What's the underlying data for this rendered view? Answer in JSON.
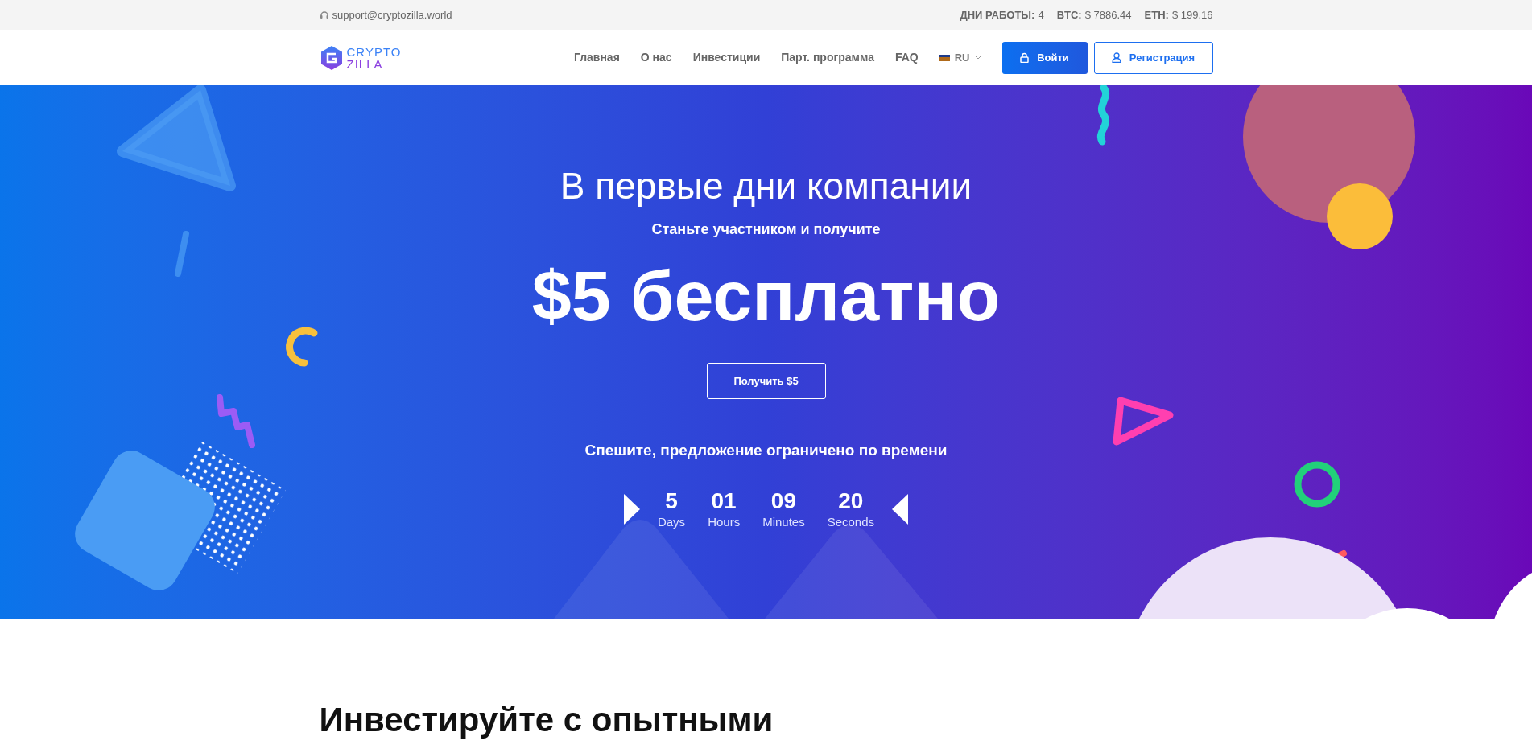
{
  "top_bar": {
    "email": "support@cryptozilla.world",
    "stats": [
      {
        "label": "ДНИ РАБОТЫ:",
        "value": "4"
      },
      {
        "label": "BTC:",
        "value": "$ 7886.44"
      },
      {
        "label": "ETH:",
        "value": "$ 199.16"
      }
    ]
  },
  "header": {
    "logo": {
      "line_1": "CRYPTO",
      "line_2": "ZILLA"
    },
    "nav": [
      "Главная",
      "О нас",
      "Инвестиции",
      "Парт. программа",
      "FAQ"
    ],
    "language": "RU",
    "buttons": [
      {
        "label": "Войти",
        "kind": "primary"
      },
      {
        "label": "Регистрация",
        "kind": "outline"
      }
    ]
  },
  "hero": {
    "title": "В первые дни компании",
    "subtitle": "Станьте участником и получите",
    "headline": "$5 бесплатно",
    "button": "Получить $5",
    "note": "Спешите, предложение ограничено по времени",
    "countdown": [
      {
        "value": "5",
        "unit": "Days"
      },
      {
        "value": "01",
        "unit": "Hours"
      },
      {
        "value": "09",
        "unit": "Minutes"
      },
      {
        "value": "20",
        "unit": "Seconds"
      }
    ]
  },
  "section": {
    "heading": "Инвестируйте с опытными"
  }
}
